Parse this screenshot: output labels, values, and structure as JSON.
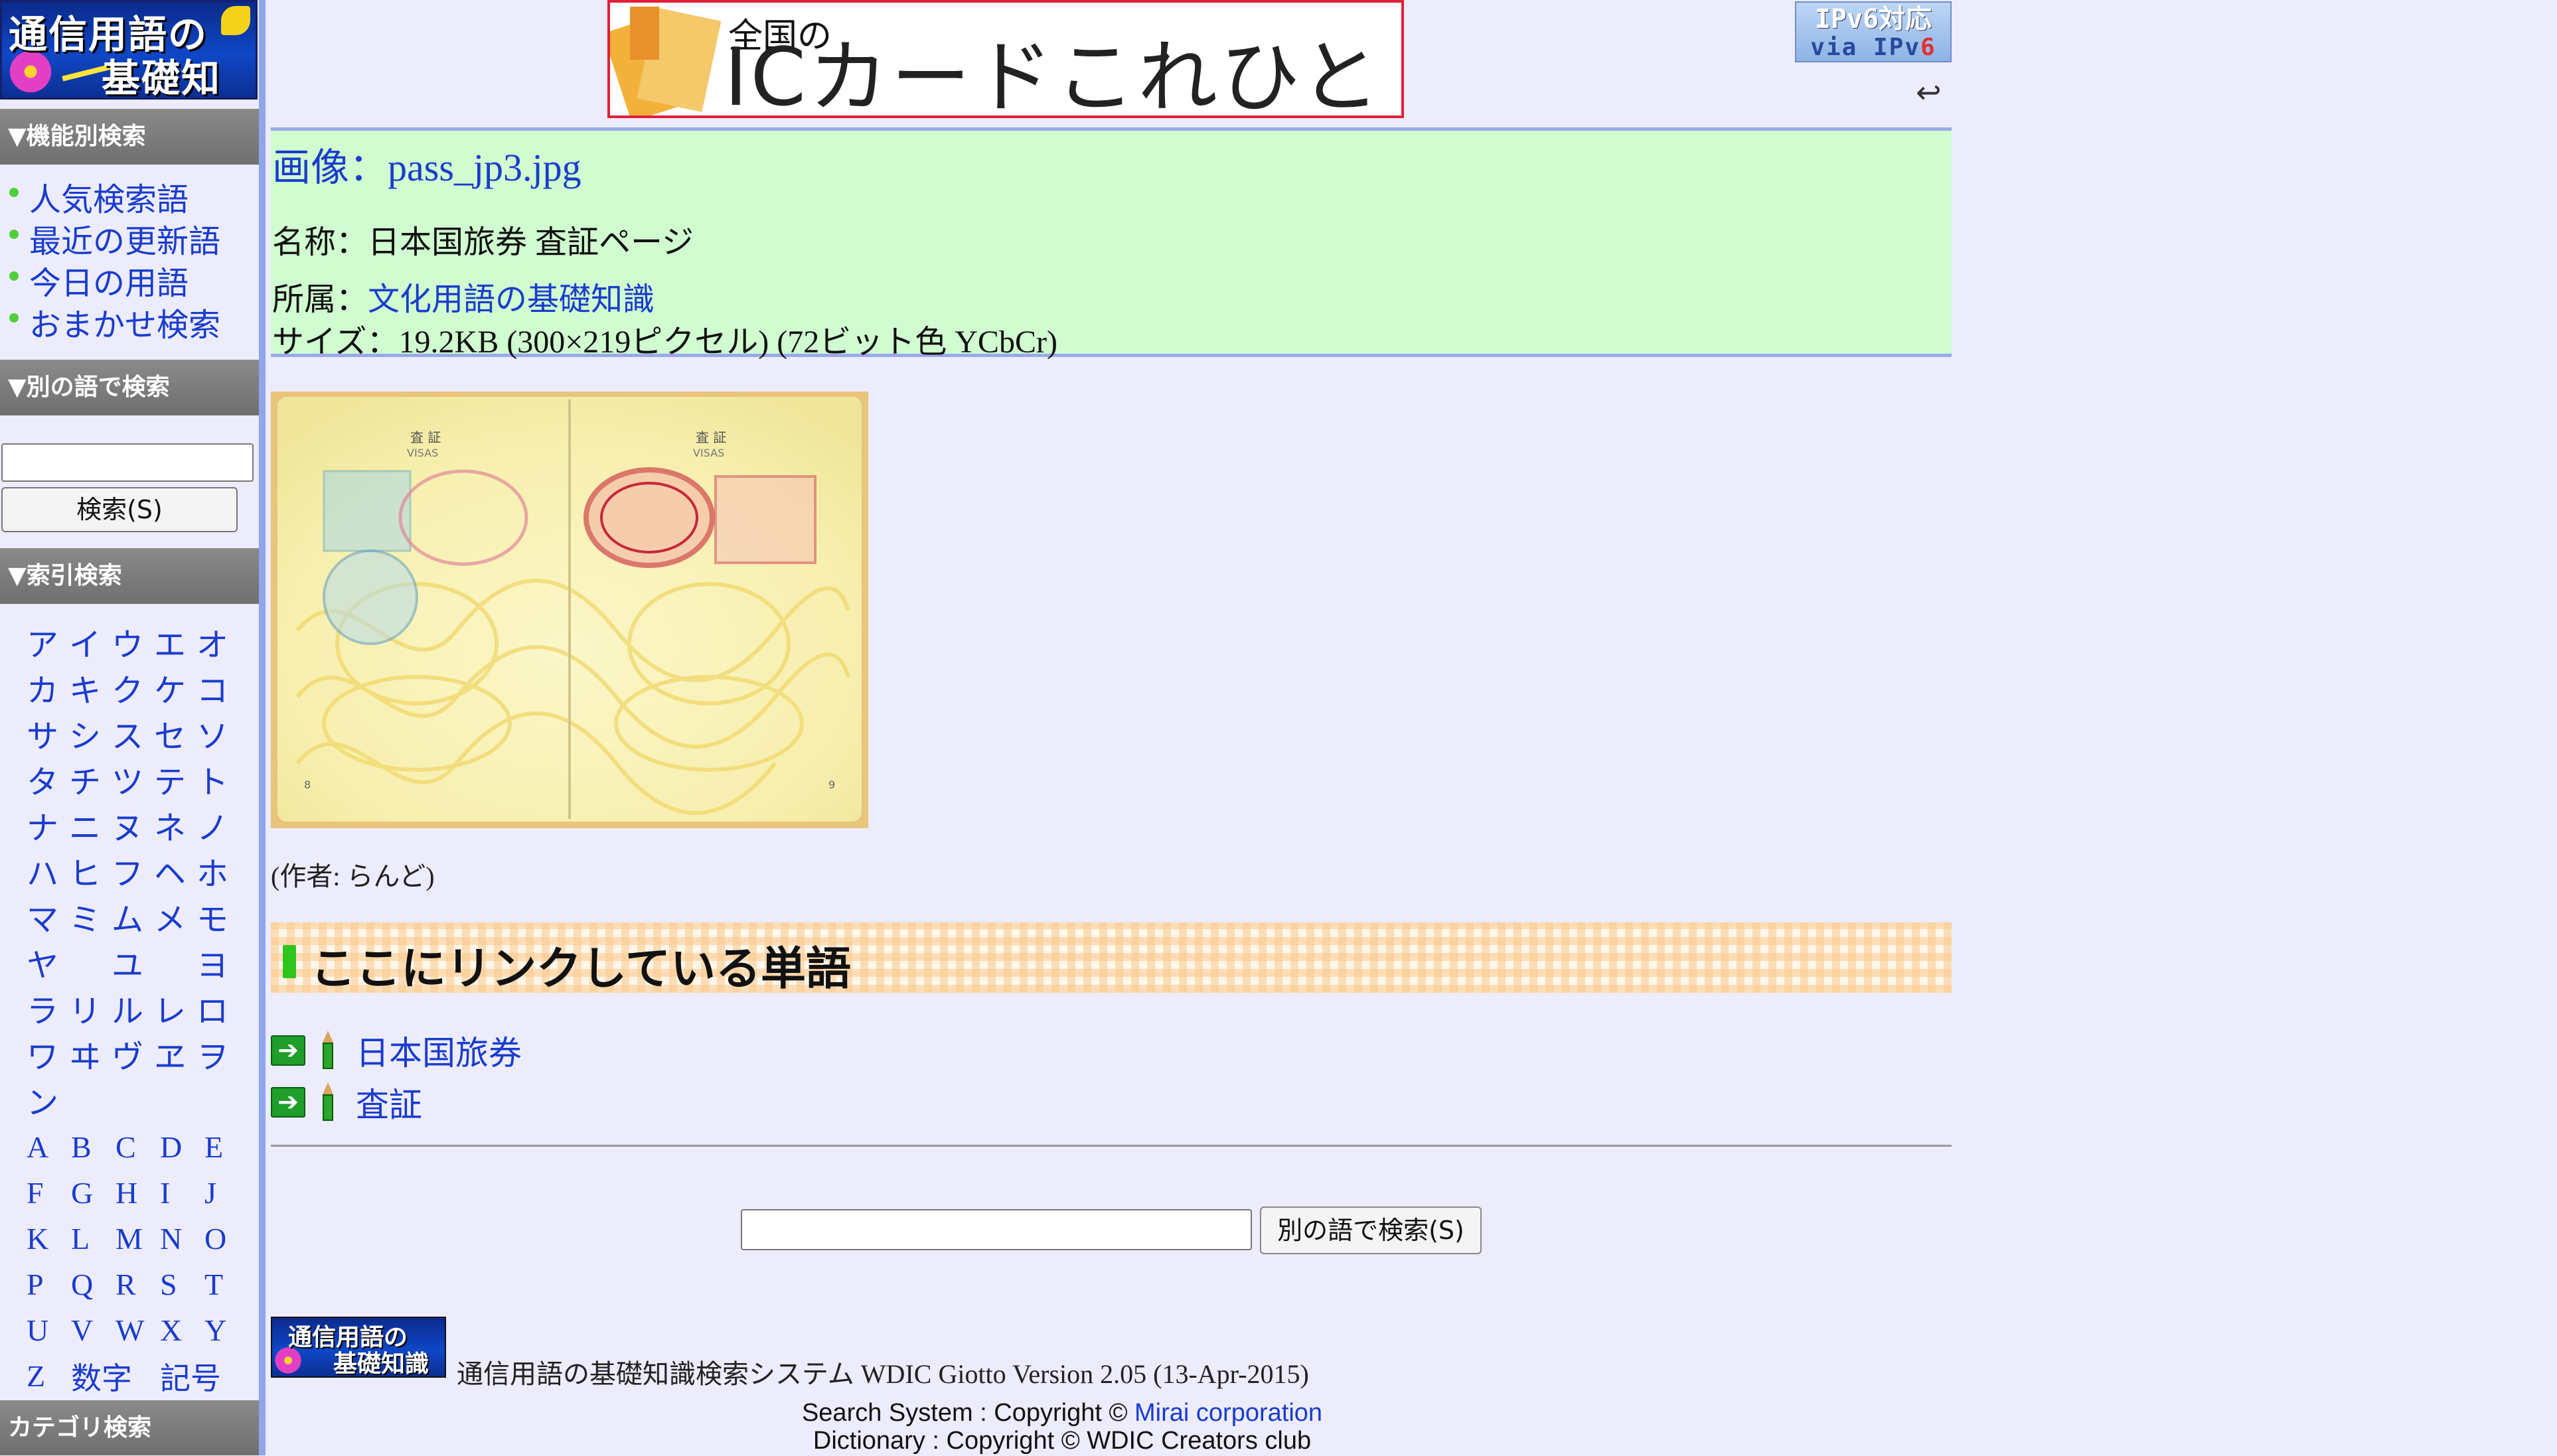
{
  "sidebar": {
    "logo_text_line1": "通信用語の",
    "logo_text_line2": "基礎知識",
    "section_feature": "▼機能別検索",
    "feature_items": [
      "人気検索語",
      "最近の更新語",
      "今日の用語",
      "おまかせ検索"
    ],
    "section_other": "▼別の語で検索",
    "search_placeholder": "",
    "search_button": "検索(S)",
    "section_index": "▼索引検索",
    "kana_rows": [
      [
        "ア",
        "イ",
        "ウ",
        "エ",
        "オ"
      ],
      [
        "カ",
        "キ",
        "ク",
        "ケ",
        "コ"
      ],
      [
        "サ",
        "シ",
        "ス",
        "セ",
        "ソ"
      ],
      [
        "タ",
        "チ",
        "ツ",
        "テ",
        "ト"
      ],
      [
        "ナ",
        "ニ",
        "ヌ",
        "ネ",
        "ノ"
      ],
      [
        "ハ",
        "ヒ",
        "フ",
        "ヘ",
        "ホ"
      ],
      [
        "マ",
        "ミ",
        "ム",
        "メ",
        "モ"
      ],
      [
        "ヤ",
        "",
        "ユ",
        "",
        "ヨ"
      ],
      [
        "ラ",
        "リ",
        "ル",
        "レ",
        "ロ"
      ],
      [
        "ワ",
        "ヰ",
        "ヴ",
        "ヱ",
        "ヲ"
      ],
      [
        "ン",
        "",
        "",
        "",
        ""
      ]
    ],
    "alpha_rows": [
      [
        "A",
        "B",
        "C",
        "D",
        "E"
      ],
      [
        "F",
        "G",
        "H",
        "I",
        "J"
      ],
      [
        "K",
        "L",
        "M",
        "N",
        "O"
      ],
      [
        "P",
        "Q",
        "R",
        "S",
        "T"
      ],
      [
        "U",
        "V",
        "W",
        "X",
        "Y"
      ],
      [
        "Z",
        "数字",
        "",
        "記号",
        ""
      ]
    ],
    "section_category": "カテゴリ検索"
  },
  "banner": {
    "small": "全国の",
    "big": "ICカードこれひとつ"
  },
  "ipv6": {
    "line1": "IPv6対応",
    "line2a": "via IPv",
    "line2b": "6"
  },
  "back_icon": "↩",
  "info": {
    "title": "画像：pass_jp3.jpg",
    "name": "名称：日本国旅券 査証ページ",
    "belong_label": "所属：",
    "belong_link": "文化用語の基礎知識",
    "size": "サイズ：19.2KB (300×219ピクセル) (72ビット色 YCbCr)"
  },
  "image": {
    "left_label": "査 証",
    "left_sub": "VISAS",
    "right_label": "査 証",
    "right_sub": "VISAS",
    "page_left": "8",
    "page_right": "9"
  },
  "author": "(作者: らんど)",
  "linked": {
    "heading": "ここにリンクしている単語",
    "items": [
      "日本国旅券",
      "査証"
    ]
  },
  "bottom_search": {
    "placeholder": "",
    "button": "別の語で検索(S)"
  },
  "footer": {
    "logo_line1": "通信用語の",
    "logo_line2": "基礎知識",
    "system": "通信用語の基礎知識検索システム WDIC Giotto Version 2.05 (13-Apr-2015)",
    "copy1_prefix": "Search System : Copyright © ",
    "copy1_link": "Mirai corporation",
    "copy2": "Dictionary : Copyright © WDIC Creators club"
  },
  "colors": {
    "link": "#1a3ccc",
    "info_bg": "#d0fcd0",
    "page_bg": "#ececfc",
    "sidebar_head": "#7a7a7a",
    "accent_green": "#2fc51e"
  }
}
